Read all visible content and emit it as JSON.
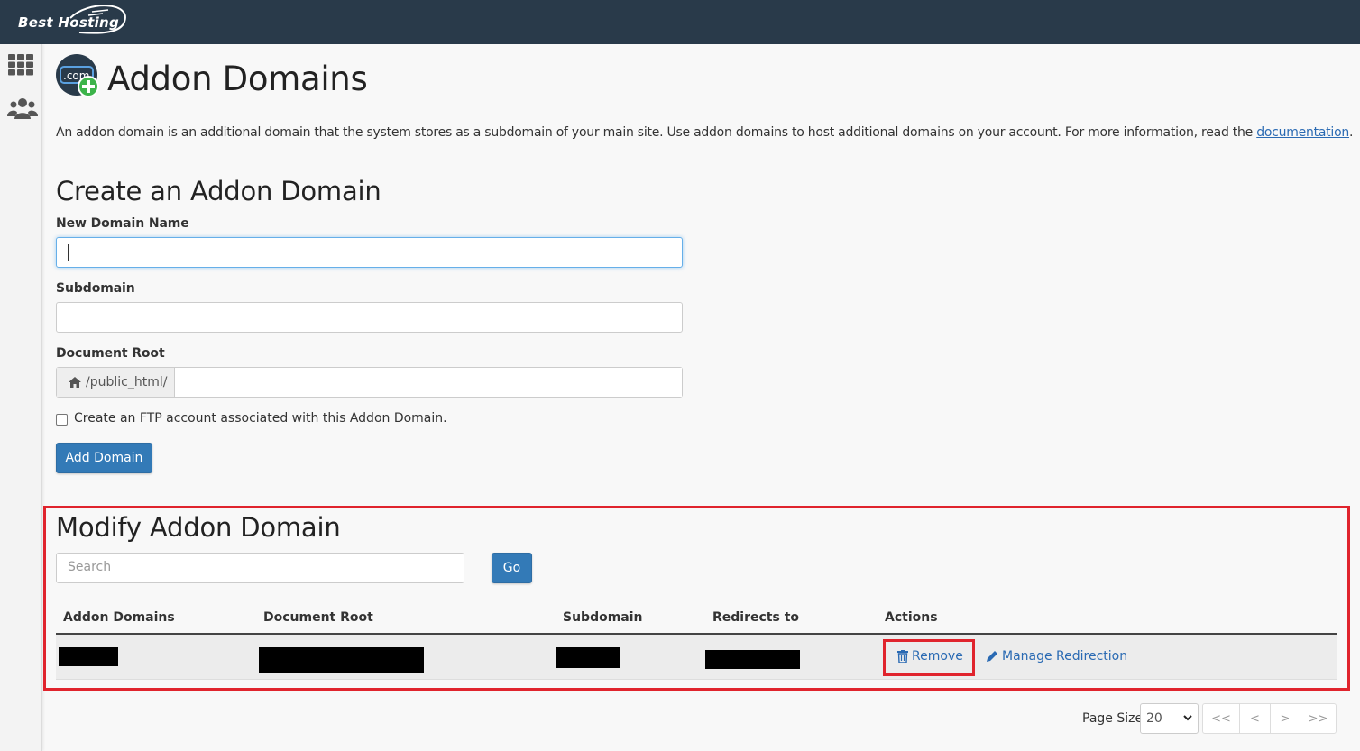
{
  "brand": {
    "logo_text": "Best Hosting"
  },
  "sidebar": {
    "items": [
      {
        "icon": "grid-icon"
      },
      {
        "icon": "users-icon"
      }
    ]
  },
  "page": {
    "title": "Addon Domains",
    "intro_text": "An addon domain is an additional domain that the system stores as a subdomain of your main site. Use addon domains to host additional domains on your account. For more information, read the ",
    "intro_link": "documentation",
    "intro_end": "."
  },
  "create": {
    "title": "Create an Addon Domain",
    "new_domain_label": "New Domain Name",
    "new_domain_value": "",
    "subdomain_label": "Subdomain",
    "subdomain_value": "",
    "docroot_label": "Document Root",
    "docroot_prefix": "/public_html/",
    "docroot_value": "",
    "ftp_checkbox_label": "Create an FTP account associated with this Addon Domain.",
    "ftp_checked": false,
    "submit_label": "Add Domain"
  },
  "modify": {
    "title": "Modify Addon Domain",
    "search_placeholder": "Search",
    "go_label": "Go",
    "columns": [
      "Addon Domains",
      "Document Root",
      "Subdomain",
      "Redirects to",
      "Actions"
    ],
    "rows": [
      {
        "addon_domain": "[redacted]",
        "document_root": "[redacted]",
        "subdomain": "[redacted]",
        "redirects_to": "[redacted]"
      }
    ],
    "actions": {
      "remove": "Remove",
      "manage_redirection": "Manage Redirection"
    }
  },
  "pager": {
    "page_size_label": "Page Size",
    "page_size_value": "20",
    "buttons": [
      "<<",
      "<",
      ">",
      ">>"
    ]
  },
  "colors": {
    "topbar": "#293a4a",
    "primary": "#337ab7",
    "link": "#2a6ab3",
    "highlight": "#e0242d"
  }
}
